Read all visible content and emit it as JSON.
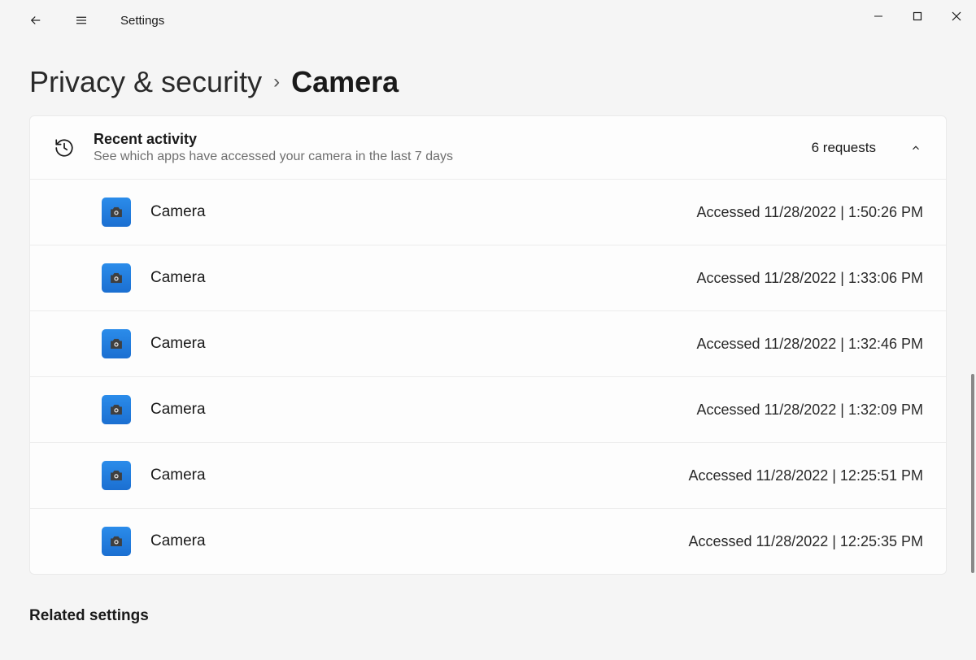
{
  "app": {
    "title": "Settings"
  },
  "breadcrumb": {
    "parent": "Privacy & security",
    "current": "Camera"
  },
  "panel": {
    "title": "Recent activity",
    "subtitle": "See which apps have accessed your camera in the last 7 days",
    "count": "6 requests"
  },
  "activity": [
    {
      "app": "Camera",
      "access": "Accessed 11/28/2022  |  1:50:26 PM"
    },
    {
      "app": "Camera",
      "access": "Accessed 11/28/2022  |  1:33:06 PM"
    },
    {
      "app": "Camera",
      "access": "Accessed 11/28/2022  |  1:32:46 PM"
    },
    {
      "app": "Camera",
      "access": "Accessed 11/28/2022  |  1:32:09 PM"
    },
    {
      "app": "Camera",
      "access": "Accessed 11/28/2022  |  12:25:51 PM"
    },
    {
      "app": "Camera",
      "access": "Accessed 11/28/2022  |  12:25:35 PM"
    }
  ],
  "related": {
    "heading": "Related settings"
  }
}
